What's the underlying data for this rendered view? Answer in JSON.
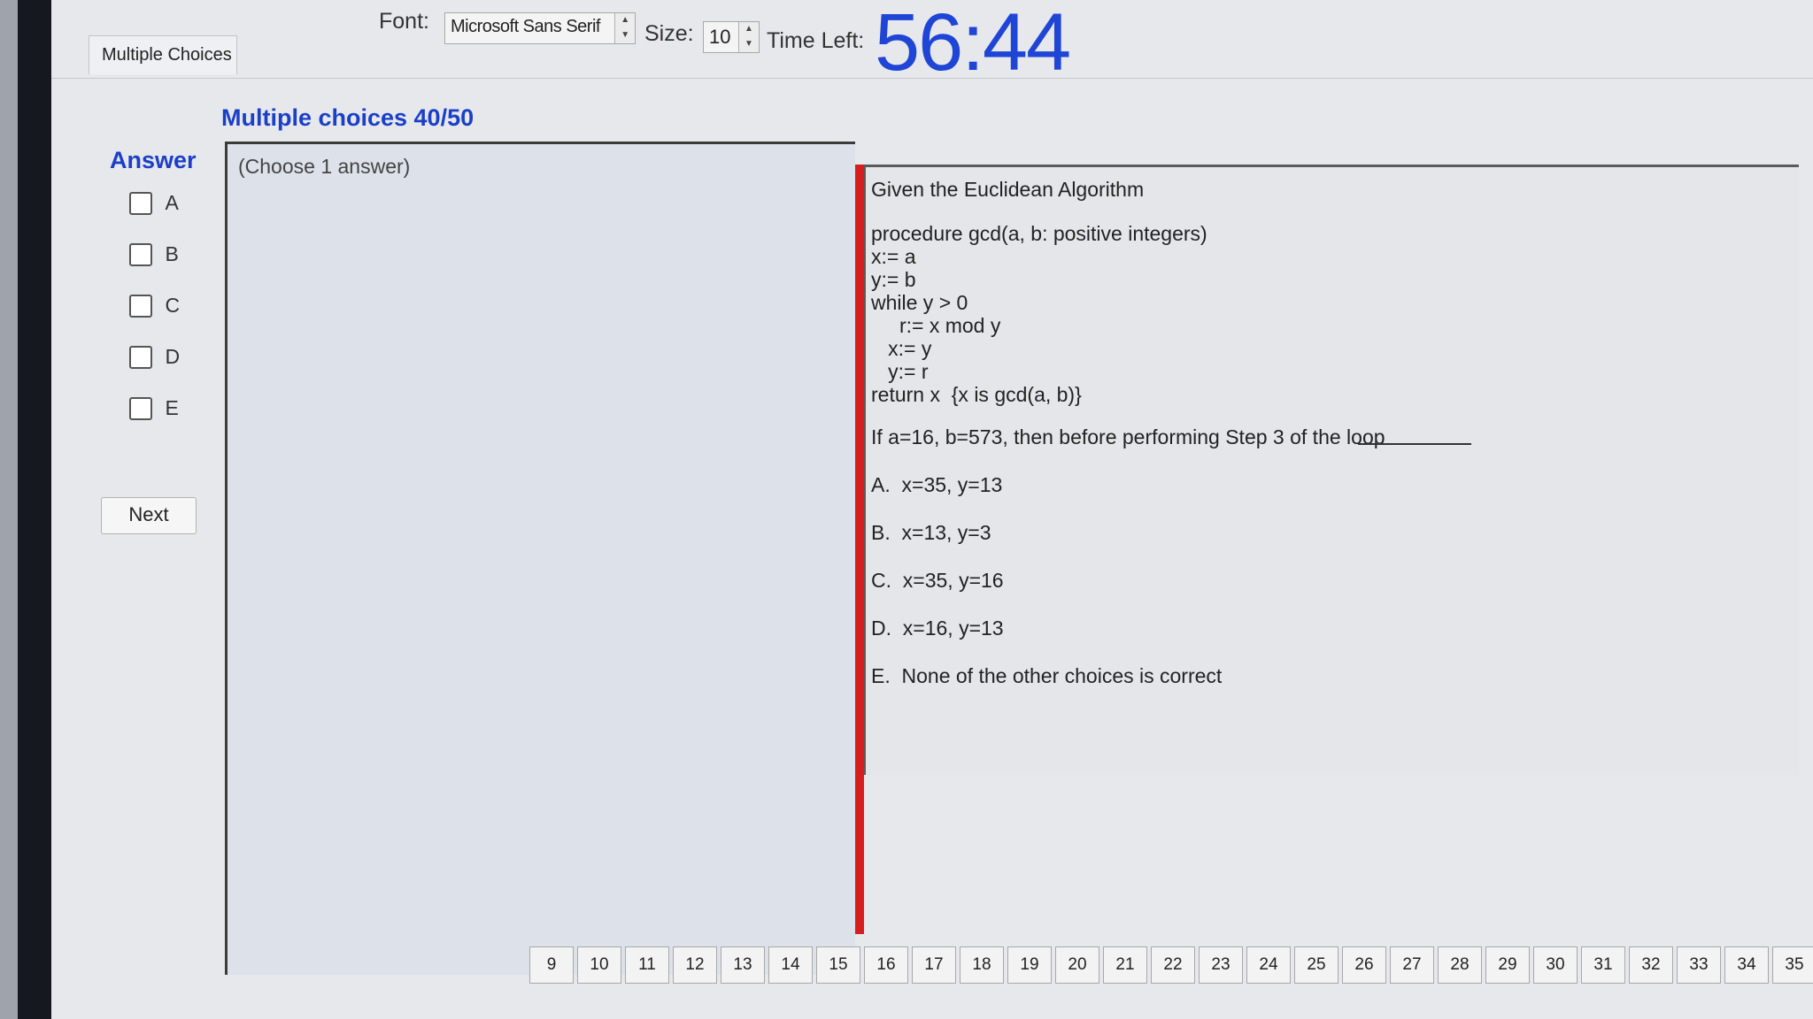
{
  "toolbar": {
    "font_label": "Font:",
    "font_value": "Microsoft Sans Serif",
    "size_label": "Size:",
    "size_value": "10",
    "time_left_label": "Time Left:",
    "time_left_value": "56:44"
  },
  "tabs": {
    "active_tab": "Multiple Choices"
  },
  "section_title": "Multiple choices 40/50",
  "answer": {
    "title": "Answer",
    "options": [
      "A",
      "B",
      "C",
      "D",
      "E"
    ],
    "next_label": "Next",
    "instruction": "(Choose 1 answer)"
  },
  "question": {
    "lines": [
      "Given the Euclidean Algorithm",
      "procedure gcd(a, b: positive integers)",
      "x:= a",
      "y:= b",
      "while y > 0",
      "     r:= x mod y",
      "   x:= y",
      "   y:= r",
      "return x  {x is gcd(a, b)}",
      "If a=16, b=573, then before performing Step 3 of the loop",
      "A.  x=35, y=13",
      "B.  x=13, y=3",
      "C.  x=35, y=16",
      "D.  x=16, y=13",
      "E.  None of the other choices is correct"
    ]
  },
  "question_tabs": [
    "9",
    "10",
    "11",
    "12",
    "13",
    "14",
    "15",
    "16",
    "17",
    "18",
    "19",
    "20",
    "21",
    "22",
    "23",
    "24",
    "25",
    "26",
    "27",
    "28",
    "29",
    "30",
    "31",
    "32",
    "33",
    "34",
    "35"
  ],
  "colors": {
    "accent_blue": "#1c3fc7",
    "timer_blue": "#1f45d6",
    "divider_red": "#d71e1e"
  }
}
